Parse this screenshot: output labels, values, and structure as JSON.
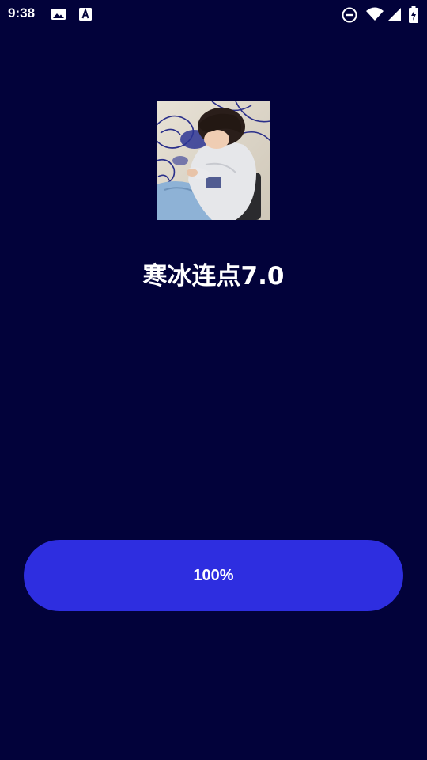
{
  "status_bar": {
    "time": "9:38",
    "icons": [
      "image-icon",
      "font-a-icon",
      "do-not-disturb-icon",
      "wifi-icon",
      "signal-icon",
      "battery-charging-icon"
    ]
  },
  "app": {
    "avatar_icon": "avatar-photo",
    "title": "寒冰连点7.0"
  },
  "loading": {
    "label": "100%",
    "progress": 1.0
  },
  "colors": {
    "background": "#02023a",
    "button": "#2e2ee0",
    "text": "#ffffff"
  }
}
